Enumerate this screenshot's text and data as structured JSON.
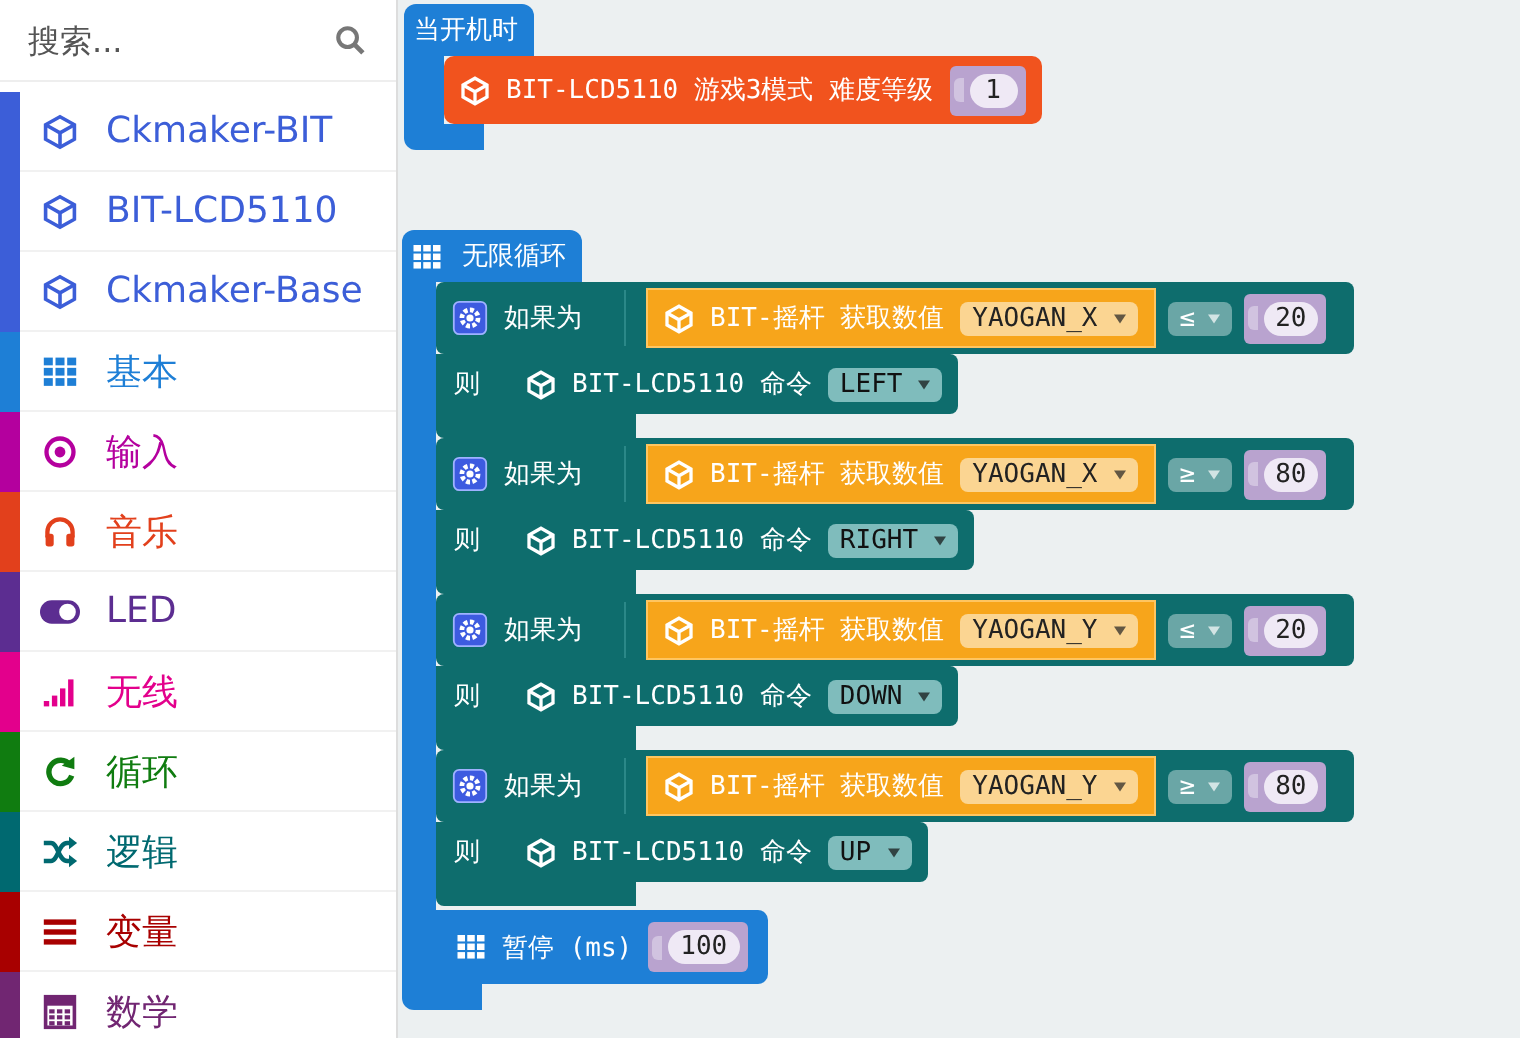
{
  "sidebar": {
    "search": {
      "placeholder": "搜索..."
    },
    "categories": [
      {
        "label": "Ckmaker-BIT",
        "color": "#3c5ed8"
      },
      {
        "label": "BIT-LCD5110",
        "color": "#3c5ed8"
      },
      {
        "label": "Ckmaker-Base",
        "color": "#3c5ed8"
      },
      {
        "label": "基本",
        "color": "#1e7fd6"
      },
      {
        "label": "输入",
        "color": "#b4009e"
      },
      {
        "label": "音乐",
        "color": "#e2401c"
      },
      {
        "label": "LED",
        "color": "#5c2d91"
      },
      {
        "label": "无线",
        "color": "#e3008c"
      },
      {
        "label": "循环",
        "color": "#107c10"
      },
      {
        "label": "逻辑",
        "color": "#006970"
      },
      {
        "label": "变量",
        "color": "#a80000"
      },
      {
        "label": "数学",
        "color": "#712672"
      }
    ]
  },
  "workspace": {
    "on_start": {
      "label": "当开机时",
      "statements": [
        {
          "text": "BIT-LCD5110 游戏3模式 难度等级",
          "value": "1"
        }
      ]
    },
    "forever": {
      "label": "无限循环",
      "statements": [
        {
          "kind": "if",
          "if_label": "如果为",
          "condition": {
            "text": "BIT-摇杆 获取数值",
            "dropdown": "YAOGAN_X",
            "operator": "≤",
            "value": "20"
          },
          "then_label": "则",
          "then": {
            "text": "BIT-LCD5110 命令",
            "dropdown": "LEFT"
          }
        },
        {
          "kind": "if",
          "if_label": "如果为",
          "condition": {
            "text": "BIT-摇杆 获取数值",
            "dropdown": "YAOGAN_X",
            "operator": "≥",
            "value": "80"
          },
          "then_label": "则",
          "then": {
            "text": "BIT-LCD5110 命令",
            "dropdown": "RIGHT"
          }
        },
        {
          "kind": "if",
          "if_label": "如果为",
          "condition": {
            "text": "BIT-摇杆 获取数值",
            "dropdown": "YAOGAN_Y",
            "operator": "≤",
            "value": "20"
          },
          "then_label": "则",
          "then": {
            "text": "BIT-LCD5110 命令",
            "dropdown": "DOWN"
          }
        },
        {
          "kind": "if",
          "if_label": "如果为",
          "condition": {
            "text": "BIT-摇杆 获取数值",
            "dropdown": "YAOGAN_Y",
            "operator": "≥",
            "value": "80"
          },
          "then_label": "则",
          "then": {
            "text": "BIT-LCD5110 命令",
            "dropdown": "UP"
          }
        },
        {
          "kind": "pause",
          "label": "暂停 (ms)",
          "value": "100"
        }
      ]
    }
  }
}
